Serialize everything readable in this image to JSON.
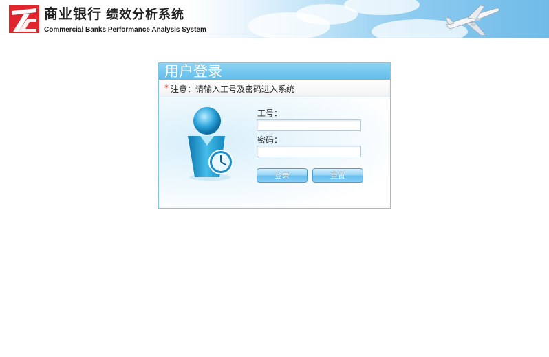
{
  "header": {
    "title_cn": "商业银行",
    "subtitle_cn": "绩效分析系统",
    "title_en": "Commercial Banks  Performance Analysls System"
  },
  "login": {
    "title": "用户登录",
    "notice": "注意：请输入工号及密码进入系统",
    "notice_marker": "*",
    "employee_id_label": "工号：",
    "employee_id_value": "",
    "password_label": "密码：",
    "password_value": "",
    "login_button": "登录",
    "reset_button": "重置"
  },
  "colors": {
    "accent": "#5fbce9",
    "logo": "#e1252c",
    "notice_marker": "#e03030"
  }
}
